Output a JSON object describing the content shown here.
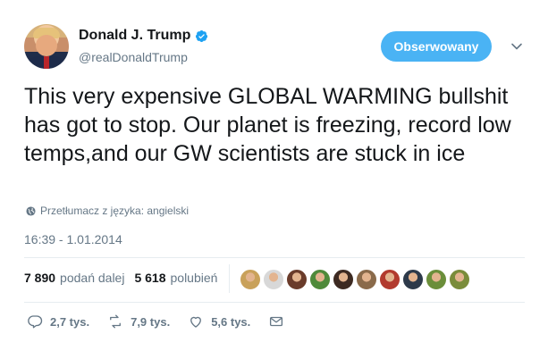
{
  "author": {
    "display_name": "Donald J. Trump",
    "handle": "@realDonaldTrump",
    "verified": true
  },
  "follow_button": {
    "label": "Obserwowany",
    "color": "#4ab3f4"
  },
  "tweet": {
    "text": "This very expensive GLOBAL WARMING bullshit has got to stop. Our planet is freezing, record low temps,and our GW scientists are stuck in ice",
    "translate_label": "Przetłumacz z języka: angielski",
    "timestamp": "16:39 - 1.01.2014"
  },
  "stats": {
    "retweets_count": "7 890",
    "retweets_label": "podań dalej",
    "likes_count": "5 618",
    "likes_label": "polubień"
  },
  "likers": [
    {
      "icon": "liker-avatar",
      "color": "#c9a15a"
    },
    {
      "icon": "liker-avatar",
      "color": "#d8d8d8"
    },
    {
      "icon": "liker-avatar",
      "color": "#6a3b2a"
    },
    {
      "icon": "liker-avatar",
      "color": "#4f8a3a"
    },
    {
      "icon": "liker-avatar",
      "color": "#3d2a22"
    },
    {
      "icon": "liker-avatar",
      "color": "#8a6a4a"
    },
    {
      "icon": "liker-avatar",
      "color": "#b23a2e"
    },
    {
      "icon": "liker-avatar",
      "color": "#2d3a4a"
    },
    {
      "icon": "liker-avatar",
      "color": "#6b8e3a"
    },
    {
      "icon": "liker-avatar",
      "color": "#7a8c3a"
    }
  ],
  "actions": {
    "reply_count": "2,7 tys.",
    "retweet_count": "7,9 tys.",
    "like_count": "5,6 tys."
  },
  "colors": {
    "secondary_text": "#657786",
    "primary_text": "#14171a",
    "accent": "#4ab3f4",
    "verified": "#1da1f2"
  }
}
